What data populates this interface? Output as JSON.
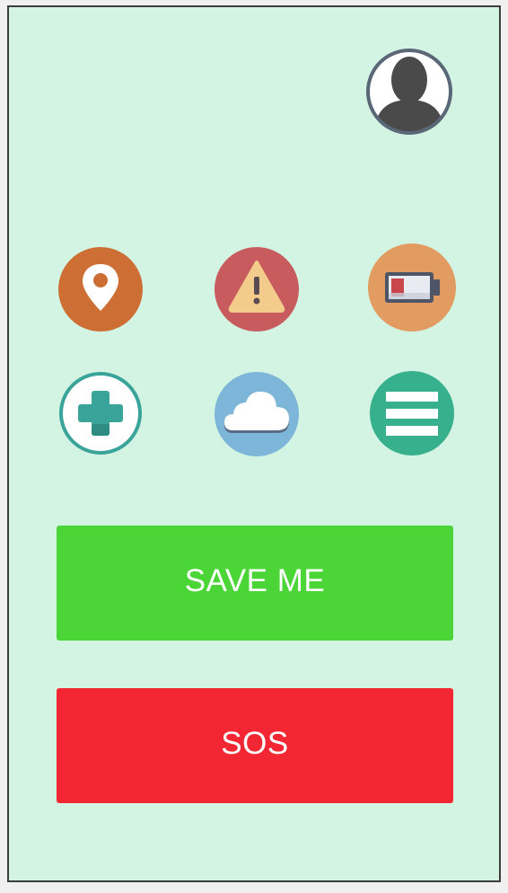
{
  "screen": {
    "background": "#d3f4e2"
  },
  "header": {
    "profile_icon": "user-avatar-icon"
  },
  "icon_grid": [
    {
      "name": "location",
      "icon": "map-pin-icon",
      "color": "#cd6f34"
    },
    {
      "name": "warning",
      "icon": "warning-triangle-icon",
      "color": "#c75b5e"
    },
    {
      "name": "battery",
      "icon": "battery-low-icon",
      "color": "#e29b60"
    },
    {
      "name": "medical",
      "icon": "medical-cross-icon",
      "color": "#3aa49a"
    },
    {
      "name": "weather",
      "icon": "cloud-icon",
      "color": "#7db6d8"
    },
    {
      "name": "menu",
      "icon": "menu-lines-icon",
      "color": "#37b08d"
    }
  ],
  "actions": {
    "save_me_label": "SAVE ME",
    "save_me_color": "#4cd537",
    "sos_label": "SOS",
    "sos_color": "#f22733"
  }
}
